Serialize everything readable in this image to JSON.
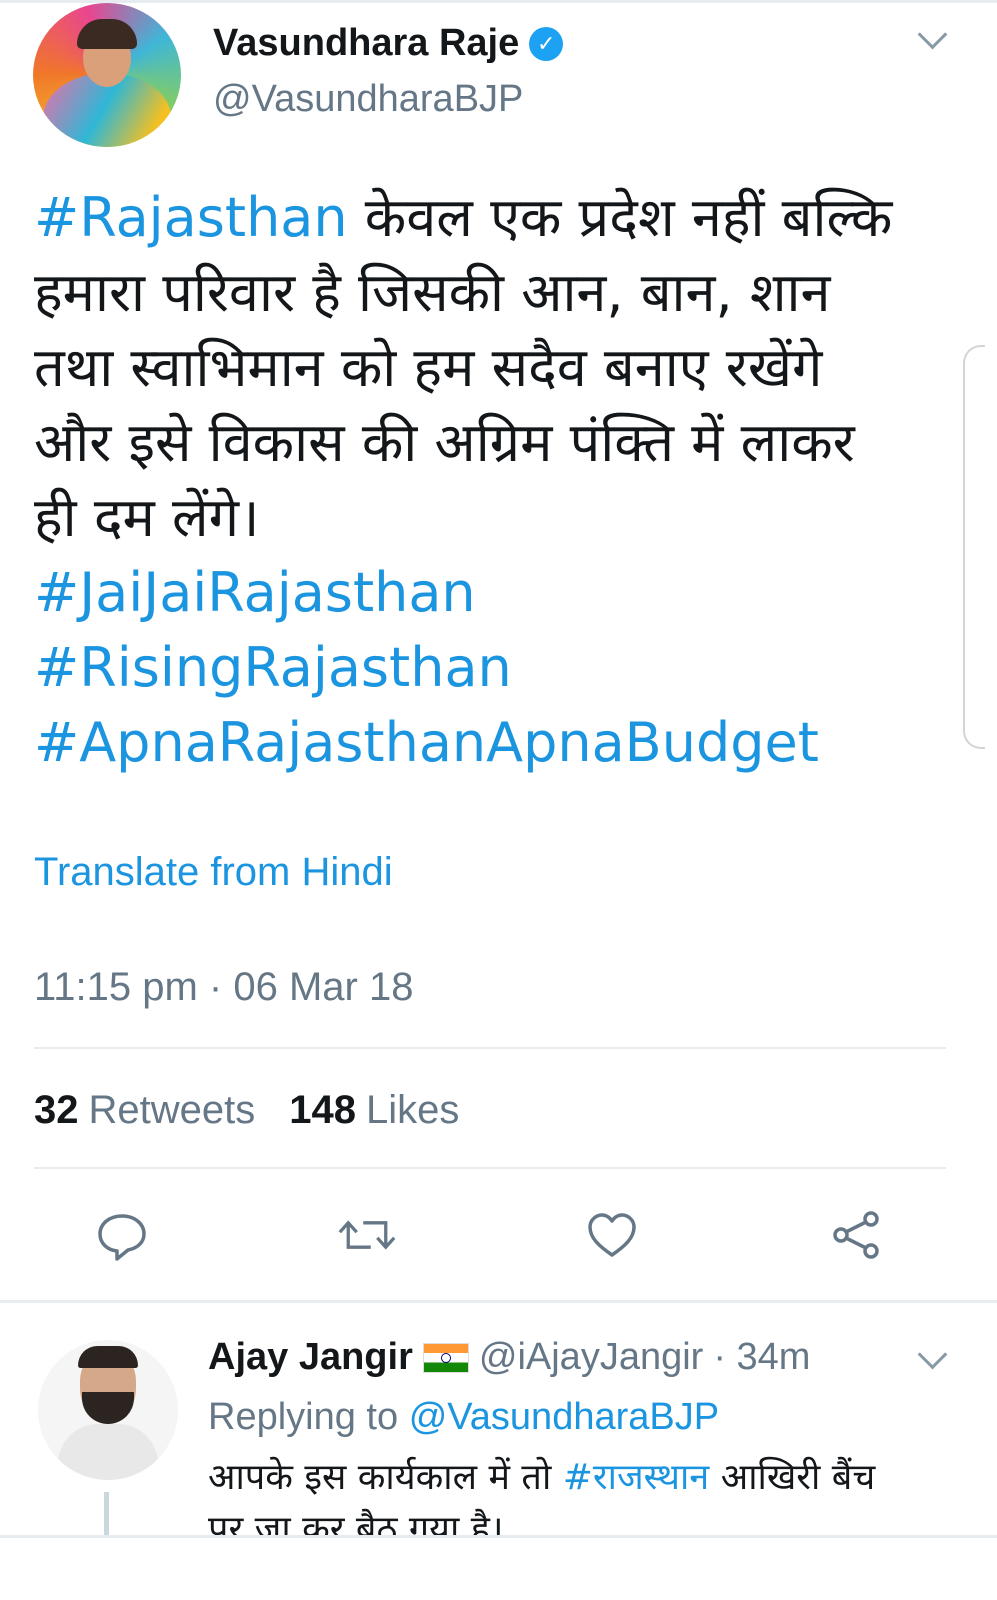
{
  "tweet": {
    "author_name": "Vasundhara Raje",
    "author_handle": "@VasundharaBJP",
    "verified_icon": "verified-badge-icon",
    "text_lines": [
      {
        "hashtag": "#Rajasthan",
        "rest": " केवल एक प्रदेश नहीं बल्कि"
      },
      {
        "hashtag": "",
        "rest": "हमारा परिवार है जिसकी आन, बान, शान"
      },
      {
        "hashtag": "",
        "rest": "तथा स्वाभिमान को हम सदैव बनाए रखेंगे"
      },
      {
        "hashtag": "",
        "rest": "और इसे विकास की अग्रिम पंक्ति में लाकर"
      },
      {
        "hashtag": "",
        "rest": "ही दम लेंगे।"
      }
    ],
    "hashtags": [
      "#JaiJaiRajasthan",
      "#RisingRajasthan",
      "#ApnaRajasthanApnaBudget"
    ],
    "translate_label": "Translate from Hindi",
    "timestamp": "11:15 pm · 06 Mar 18",
    "retweets_count": "32",
    "retweets_label": "Retweets",
    "likes_count": "148",
    "likes_label": "Likes",
    "actions": [
      "reply-icon",
      "retweet-icon",
      "like-icon",
      "share-icon"
    ]
  },
  "reply": {
    "author_name": "Ajay Jangir",
    "flag_icon": "india-flag-icon",
    "author_handle": "@iAjayJangir",
    "time": "· 34m",
    "replying_prefix": "Replying to",
    "replying_to": "@VasundharaBJP",
    "line1_before": "आपके इस कार्यकाल में तो ",
    "line1_hashtag": "#राजस्थान",
    "line1_after": " आखिरी बैंच",
    "line2": "पर जा कर बैठ गया है।"
  },
  "colors": {
    "accent": "#1b95e0",
    "secondary_text": "#657786",
    "divider": "#e6ecf0",
    "verified": "#1da1f2"
  }
}
